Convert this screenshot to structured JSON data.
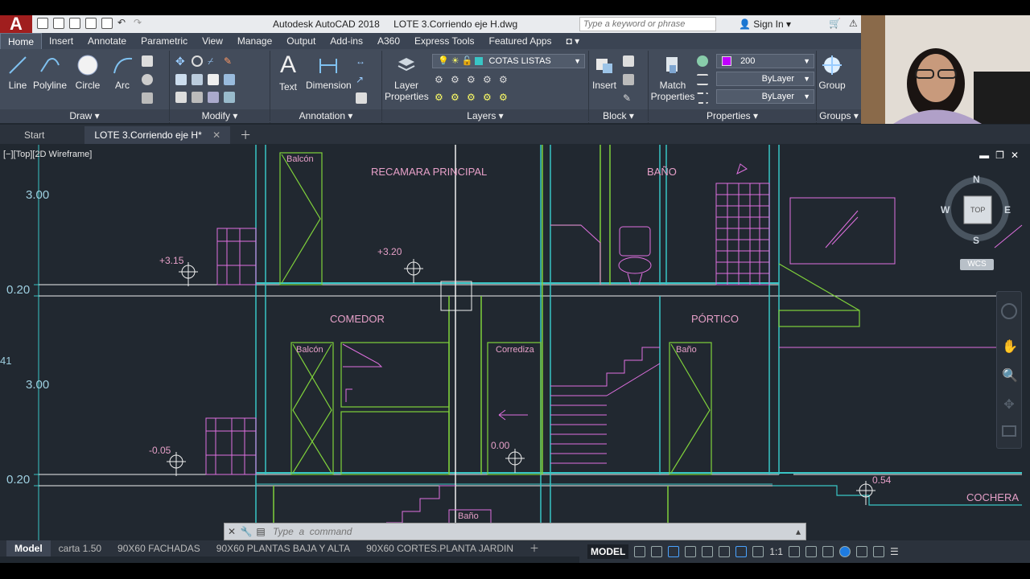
{
  "app": {
    "logo": "A",
    "title": "Autodesk AutoCAD 2018",
    "file_name": "LOTE 3.Corriendo eje H.dwg",
    "search_placeholder": "Type a keyword or phrase",
    "sign_in": "Sign In"
  },
  "ribbon_tabs": [
    "Home",
    "Insert",
    "Annotate",
    "Parametric",
    "View",
    "Manage",
    "Output",
    "Add-ins",
    "A360",
    "Express Tools",
    "Featured Apps"
  ],
  "ribbon": {
    "draw": {
      "line": "Line",
      "polyline": "Polyline",
      "circle": "Circle",
      "arc": "Arc",
      "panel": "Draw"
    },
    "modify": {
      "panel": "Modify"
    },
    "annotation": {
      "text": "Text",
      "dimension": "Dimension",
      "panel": "Annotation"
    },
    "layers": {
      "layer_properties_1": "Layer",
      "layer_properties_2": "Properties",
      "current_layer": "COTAS LISTAS",
      "panel": "Layers"
    },
    "block": {
      "insert": "Insert",
      "panel": "Block"
    },
    "properties": {
      "match_1": "Match",
      "match_2": "Properties",
      "color": "200",
      "linetype": "ByLayer",
      "lineweight": "ByLayer",
      "panel": "Properties"
    },
    "groups": {
      "group": "Group",
      "panel": "Groups"
    }
  },
  "doc_tabs": {
    "start": "Start",
    "active": "LOTE 3.Corriendo eje H*"
  },
  "viewport": {
    "label": "[−][Top][2D Wireframe]",
    "compass": {
      "n": "N",
      "s": "S",
      "e": "E",
      "w": "W",
      "top": "TOP",
      "wcs": "WCS"
    }
  },
  "drawing": {
    "dims": {
      "upper": "3.00",
      "lower": "3.00",
      "level1": "0.20",
      "level2": "0.20",
      "edge": "41"
    },
    "elevations": {
      "a": "+3.15",
      "b": "+3.20",
      "c": "-0.05",
      "d": "0.00",
      "e": "0.54"
    },
    "rooms": {
      "recamara": "RECAMARA PRINCIPAL",
      "bano_top": "BAÑO",
      "comedor": "COMEDOR",
      "portico": "PÓRTICO",
      "cochera": "COCHERA"
    },
    "labels": {
      "balcon_top": "Balcón",
      "balcon_mid": "Balcón",
      "corrediza": "Corrediza",
      "bano_mid": "Baño",
      "bano_bottom": "Baño"
    }
  },
  "command": {
    "placeholder": "Type  a  command"
  },
  "layout_tabs": [
    "Model",
    "carta 1.50",
    "90X60 FACHADAS",
    "90X60 PLANTAS BAJA Y ALTA",
    "90X60 CORTES.PLANTA JARDIN"
  ],
  "status": {
    "model": "MODEL",
    "scale": "1:1"
  },
  "colors": {
    "cyan": "#39c6c6",
    "green": "#7fd13b",
    "magenta": "#e070e0",
    "pink_text": "#e6a0c8",
    "background": "#212830"
  }
}
